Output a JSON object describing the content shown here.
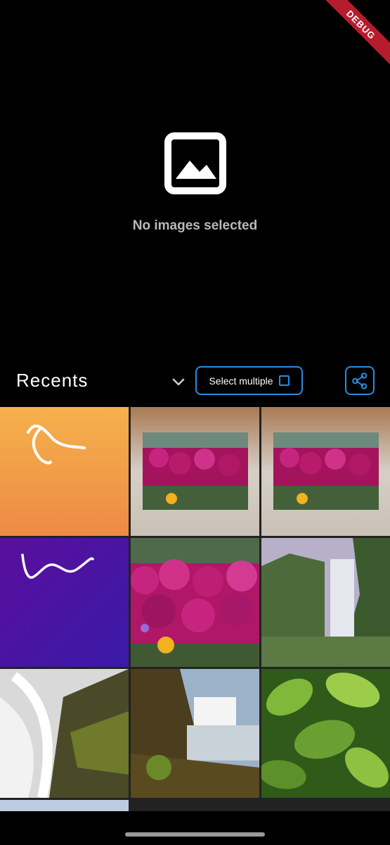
{
  "debug_banner": {
    "label": "DEBUG"
  },
  "preview": {
    "empty_text": "No images selected",
    "icon": "image-placeholder-icon"
  },
  "toolbar": {
    "album_title": "Recents",
    "dropdown_icon": "chevron-down-icon",
    "select_multiple_label": "Select multiple",
    "select_multiple_checked": false,
    "share_icon": "share-icon",
    "accent_color": "#2a8be0"
  },
  "gallery": {
    "thumbnails": [
      {
        "name": "orange-gradient-scribble"
      },
      {
        "name": "magenta-flower-field-framed"
      },
      {
        "name": "magenta-flower-field-framed"
      },
      {
        "name": "purple-gradient-scribble"
      },
      {
        "name": "magenta-flower-field"
      },
      {
        "name": "waterfall-cliff"
      },
      {
        "name": "waterfall-rocks-moss"
      },
      {
        "name": "waterfall-canyon"
      },
      {
        "name": "green-leaves"
      },
      {
        "name": "partial-sky-thumbnail"
      }
    ]
  }
}
